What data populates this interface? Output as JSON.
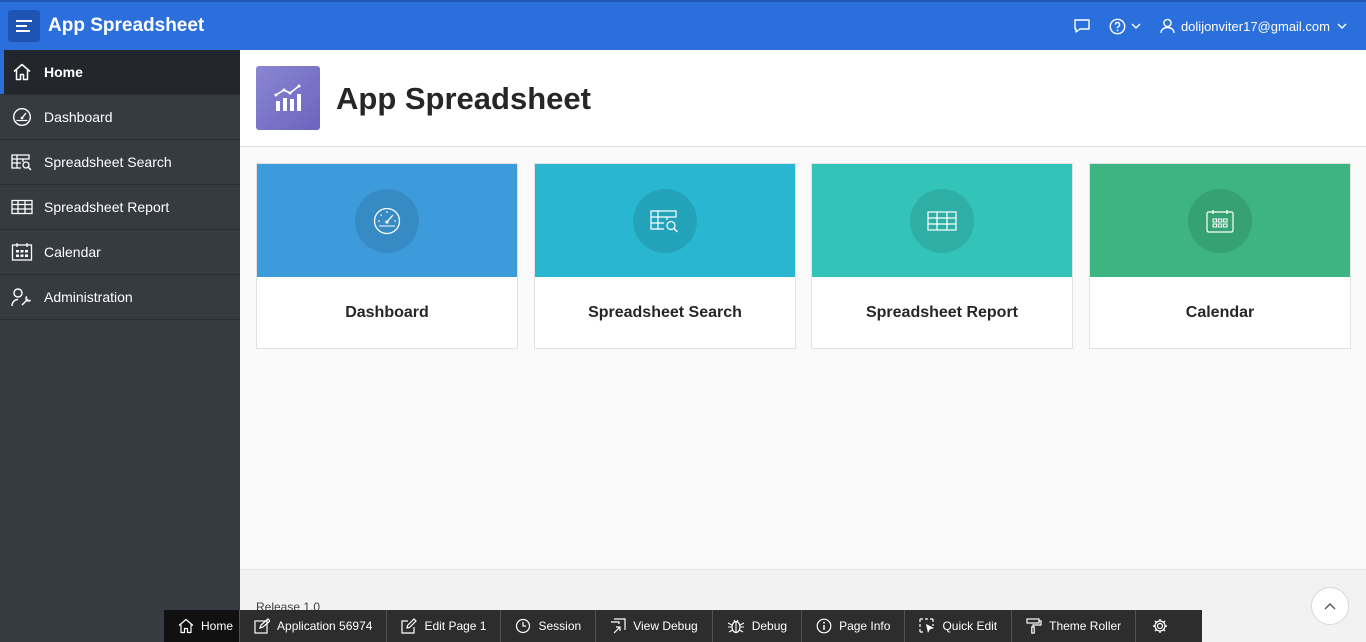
{
  "header": {
    "app_title": "App Spreadsheet",
    "user": "dolijonviter17@gmail.com",
    "icons": [
      "menu-icon",
      "feedback-icon",
      "help-icon",
      "user-icon"
    ]
  },
  "sidebar": {
    "items": [
      {
        "label": "Home",
        "icon": "home-icon",
        "active": true
      },
      {
        "label": "Dashboard",
        "icon": "gauge-icon",
        "active": false
      },
      {
        "label": "Spreadsheet Search",
        "icon": "table-search-icon",
        "active": false
      },
      {
        "label": "Spreadsheet Report",
        "icon": "table-icon",
        "active": false
      },
      {
        "label": "Calendar",
        "icon": "calendar-icon",
        "active": false
      },
      {
        "label": "Administration",
        "icon": "user-wrench-icon",
        "active": false
      }
    ]
  },
  "hero": {
    "title": "App Spreadsheet",
    "icon": "chart-icon",
    "icon_color": "#7670c8"
  },
  "cards": [
    {
      "label": "Dashboard",
      "icon": "gauge-icon",
      "color": "#3d9bdc"
    },
    {
      "label": "Spreadsheet Search",
      "icon": "table-search-icon",
      "color": "#28b6d0"
    },
    {
      "label": "Spreadsheet Report",
      "icon": "table-icon",
      "color": "#33c3b8"
    },
    {
      "label": "Calendar",
      "icon": "calendar-icon",
      "color": "#3db481"
    }
  ],
  "footer": {
    "release": "Release 1.0"
  },
  "devbar": {
    "items": [
      "Home",
      "Application 56974",
      "Edit Page 1",
      "Session",
      "View Debug",
      "Debug",
      "Page Info",
      "Quick Edit",
      "Theme Roller"
    ]
  },
  "colors": {
    "header": "#2b6fdc",
    "sidebar": "#363b41",
    "devbar": "#2d2d2d"
  }
}
